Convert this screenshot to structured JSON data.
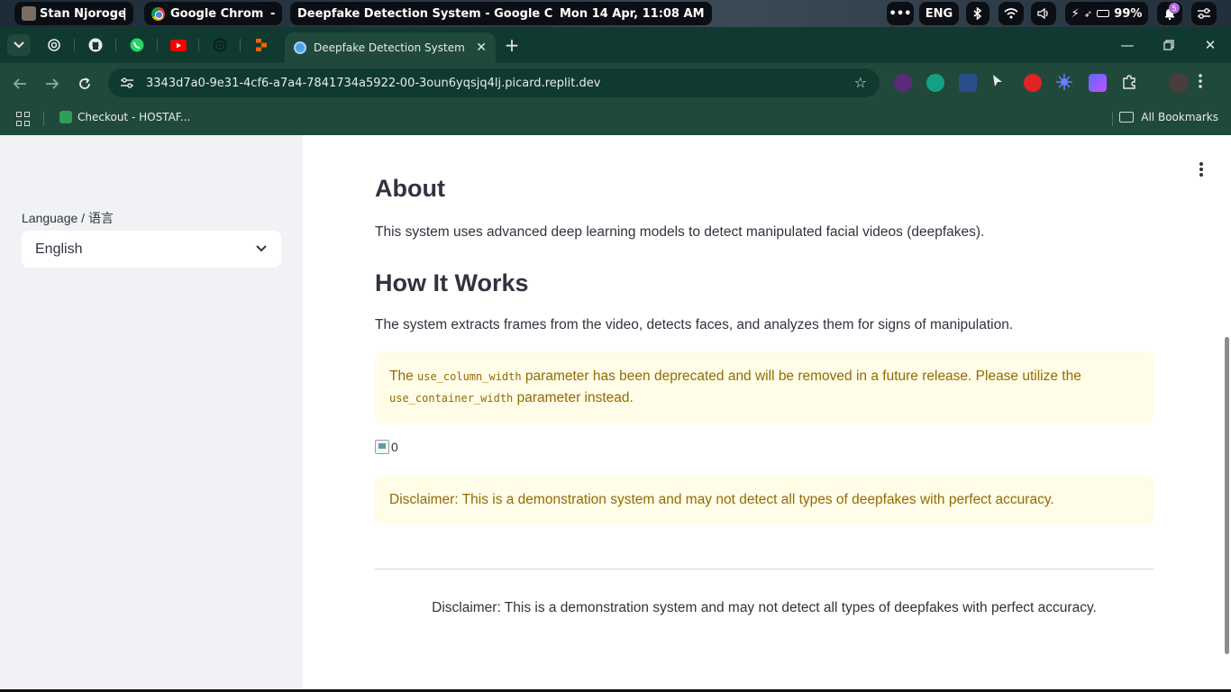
{
  "os_bar": {
    "user_name": "Stan Njoroge",
    "separator": "|",
    "app_name": "Google Chrome",
    "dash": "-",
    "window_title": "Deepfake Detection System - Google Chrome",
    "datetime": "Mon 14 Apr, 11:08 AM",
    "more": "•••",
    "language": "ENG",
    "battery": "99%",
    "notification_count": "5"
  },
  "browser": {
    "active_tab_title": "Deepfake Detection System",
    "url": "3343d7a0-9e31-4cf6-a7a4-7841734a5922-00-3oun6yqsjq4lj.picard.replit.dev",
    "bookmark_1": "Checkout - HOSTAF...",
    "all_bookmarks": "All Bookmarks"
  },
  "sidebar": {
    "language_label": "Language / 语言",
    "language_value": "English"
  },
  "main": {
    "about_heading": "About",
    "about_text": "This system uses advanced deep learning models to detect manipulated facial videos (deepfakes).",
    "how_heading": "How It Works",
    "how_text": "The system extracts frames from the video, detects faces, and analyzes them for signs of manipulation.",
    "warning": {
      "prefix": "The ",
      "code_1": "use_column_width",
      "middle": " parameter has been deprecated and will be removed in a future release. Please utilize the ",
      "code_2": "use_container_width",
      "suffix": " parameter instead."
    },
    "image_alt": "0",
    "disclaimer_alert": "Disclaimer: This is a demonstration system and may not detect all types of deepfakes with perfect accuracy.",
    "footer_disclaimer": "Disclaimer: This is a demonstration system and may not detect all types of deepfakes with perfect accuracy."
  },
  "colors": {
    "tab_strip": "#103a2f",
    "toolbar": "#20493c",
    "sidebar_bg": "#f0f2f6",
    "warning_bg": "#fffce7",
    "warning_text": "#926c05"
  }
}
